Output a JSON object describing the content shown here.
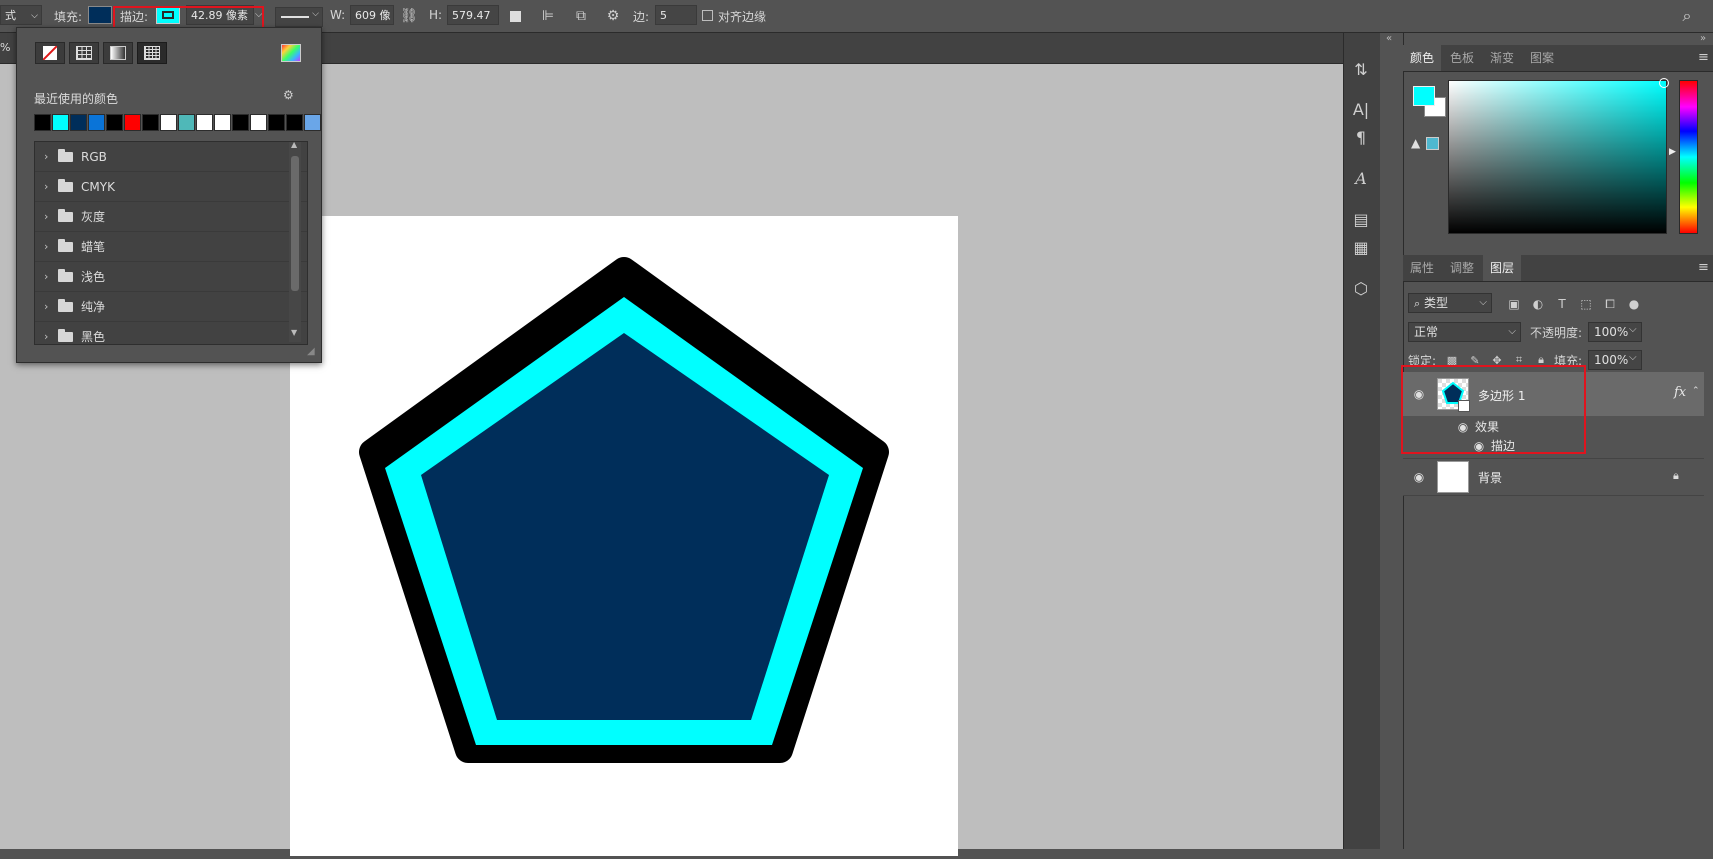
{
  "toolbar": {
    "mode_cut": "式",
    "fill_label": "填充:",
    "stroke_label": "描边:",
    "stroke_width": "42.89 像素",
    "w_label": "W:",
    "w_value": "609 像",
    "h_label": "H:",
    "h_value": "579.47",
    "sides_label": "边:",
    "sides_value": "5",
    "align_edges_label": "对齐边缘",
    "fill_color": "#002e5a",
    "stroke_color": "#00ffff"
  },
  "tab": {
    "zoom_fragment": "%"
  },
  "swatch_popup": {
    "recent_label": "最近使用的颜色",
    "recent_colors": [
      "#000000",
      "#00ffff",
      "#002e5a",
      "#0a74d8",
      "#000000",
      "#ff0000",
      "#000000",
      "#ffffff",
      "#4fb8b8",
      "#ffffff",
      "#ffffff",
      "#000000",
      "#ffffff",
      "#000000",
      "#000000",
      "#6aa6e8"
    ],
    "folders": [
      "RGB",
      "CMYK",
      "灰度",
      "蜡笔",
      "浅色",
      "纯净",
      "黑色"
    ]
  },
  "color_panel": {
    "tabs": [
      "颜色",
      "色板",
      "渐变",
      "图案"
    ],
    "active_tab": "颜色",
    "foreground": "#00ffff",
    "background": "#ffffff"
  },
  "layers_panel": {
    "tabs": [
      "属性",
      "调整",
      "图层"
    ],
    "active_tab": "图层",
    "filter_kind": "类型",
    "blend_mode": "正常",
    "opacity_label": "不透明度:",
    "opacity_value": "100%",
    "lock_label": "锁定:",
    "fill_label": "填充:",
    "fill_value": "100%",
    "layers": [
      {
        "name": "多边形 1",
        "fx": "fx",
        "effects_label": "效果",
        "effect_items": [
          "描边"
        ],
        "selected": true
      },
      {
        "name": "背景",
        "locked": true,
        "selected": false
      }
    ]
  }
}
